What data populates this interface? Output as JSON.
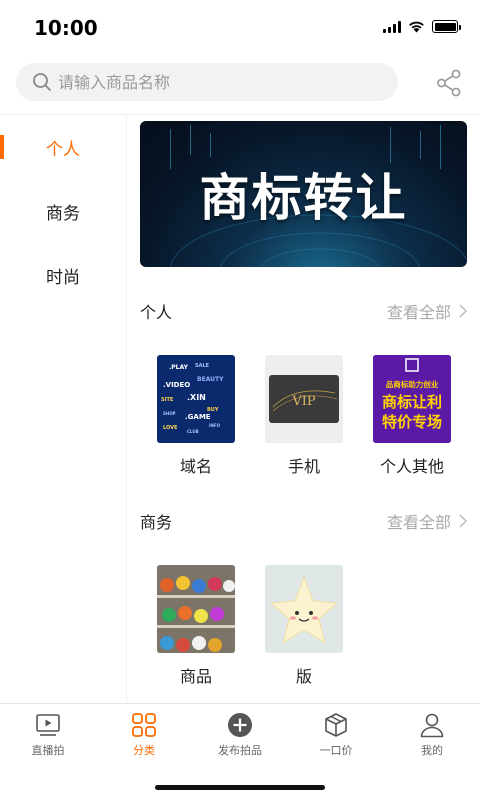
{
  "status_bar": {
    "time": "10:00"
  },
  "search": {
    "placeholder": "请输入商品名称"
  },
  "sidebar": {
    "items": [
      {
        "label": "个人",
        "active": true
      },
      {
        "label": "商务",
        "active": false
      },
      {
        "label": "时尚",
        "active": false
      }
    ]
  },
  "banner": {
    "text": "商标转让"
  },
  "sections": [
    {
      "title": "个人",
      "view_all": "查看全部",
      "items": [
        {
          "label": "域名",
          "image": "domain-names-collage"
        },
        {
          "label": "手机",
          "image": "vip-card"
        },
        {
          "label": "个人其他",
          "image": "trademark-promo"
        }
      ]
    },
    {
      "title": "商务",
      "view_all": "查看全部",
      "items": [
        {
          "label": "商品",
          "image": "store-shelves"
        },
        {
          "label": "版",
          "image": "star-plush-toy"
        }
      ]
    }
  ],
  "thumbnail_text": {
    "domain_words": [
      ".PLAY",
      "SALE",
      ".VIDEO",
      "BEAUTY",
      "SITE",
      ".XIN",
      "BUY",
      ".GAME",
      "SHOP",
      "LOVE",
      "CLUB",
      "INFO"
    ],
    "vip_card": "VIP",
    "promo_lines": [
      "品商标助力创业",
      "商标让利",
      "特价专场"
    ]
  },
  "tabbar": {
    "tabs": [
      {
        "label": "直播拍",
        "icon": "play-screen-icon",
        "active": false
      },
      {
        "label": "分类",
        "icon": "category-grid-icon",
        "active": true
      },
      {
        "label": "发布拍品",
        "icon": "plus-circle-icon",
        "active": false
      },
      {
        "label": "一口价",
        "icon": "box-icon",
        "active": false
      },
      {
        "label": "我的",
        "icon": "user-icon",
        "active": false
      }
    ]
  },
  "colors": {
    "accent": "#ff6a00",
    "text": "#222222",
    "muted": "#aaaaaa"
  }
}
